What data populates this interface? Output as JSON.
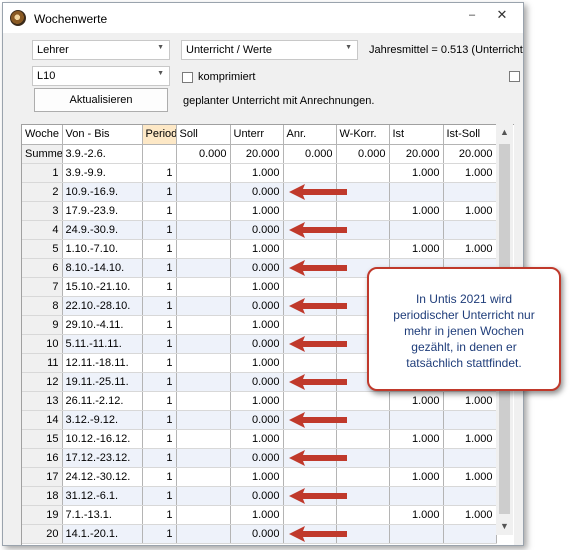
{
  "window": {
    "title": "Wochenwerte",
    "minimize": "–",
    "close": "✕"
  },
  "toolbar": {
    "lehrer": "Lehrer",
    "element": "L10",
    "mode": "Unterricht / Werte",
    "jahresmittel": "Jahresmittel = 0.513 (Unterricht",
    "komprimiert": "komprimiert",
    "aktualisieren": "Aktualisieren",
    "info": "geplanter Unterricht mit Anrechnungen."
  },
  "table": {
    "headers": [
      "Woche",
      "Von - Bis",
      "Period",
      "Soll",
      "Unterr",
      "Anr.",
      "W-Korr.",
      "Ist",
      "Ist-Soll"
    ],
    "sum": [
      "Summe",
      "3.9.-2.6.",
      "",
      "0.000",
      "20.000",
      "0.000",
      "0.000",
      "20.000",
      "20.000"
    ],
    "rows": [
      [
        "1",
        "3.9.-9.9.",
        "1",
        "",
        "1.000",
        "",
        "",
        "1.000",
        "1.000"
      ],
      [
        "2",
        "10.9.-16.9.",
        "1",
        "",
        "0.000",
        "",
        "",
        "",
        ""
      ],
      [
        "3",
        "17.9.-23.9.",
        "1",
        "",
        "1.000",
        "",
        "",
        "1.000",
        "1.000"
      ],
      [
        "4",
        "24.9.-30.9.",
        "1",
        "",
        "0.000",
        "",
        "",
        "",
        ""
      ],
      [
        "5",
        "1.10.-7.10.",
        "1",
        "",
        "1.000",
        "",
        "",
        "1.000",
        "1.000"
      ],
      [
        "6",
        "8.10.-14.10.",
        "1",
        "",
        "0.000",
        "",
        "",
        "",
        ""
      ],
      [
        "7",
        "15.10.-21.10.",
        "1",
        "",
        "1.000",
        "",
        "",
        "",
        ""
      ],
      [
        "8",
        "22.10.-28.10.",
        "1",
        "",
        "0.000",
        "",
        "",
        "",
        ""
      ],
      [
        "9",
        "29.10.-4.11.",
        "1",
        "",
        "1.000",
        "",
        "",
        "",
        ""
      ],
      [
        "10",
        "5.11.-11.11.",
        "1",
        "",
        "0.000",
        "",
        "",
        "",
        ""
      ],
      [
        "11",
        "12.11.-18.11.",
        "1",
        "",
        "1.000",
        "",
        "",
        "",
        ""
      ],
      [
        "12",
        "19.11.-25.11.",
        "1",
        "",
        "0.000",
        "",
        "",
        "",
        ""
      ],
      [
        "13",
        "26.11.-2.12.",
        "1",
        "",
        "1.000",
        "",
        "",
        "1.000",
        "1.000"
      ],
      [
        "14",
        "3.12.-9.12.",
        "1",
        "",
        "0.000",
        "",
        "",
        "",
        ""
      ],
      [
        "15",
        "10.12.-16.12.",
        "1",
        "",
        "1.000",
        "",
        "",
        "1.000",
        "1.000"
      ],
      [
        "16",
        "17.12.-23.12.",
        "1",
        "",
        "0.000",
        "",
        "",
        "",
        ""
      ],
      [
        "17",
        "24.12.-30.12.",
        "1",
        "",
        "1.000",
        "",
        "",
        "1.000",
        "1.000"
      ],
      [
        "18",
        "31.12.-6.1.",
        "1",
        "",
        "0.000",
        "",
        "",
        "",
        ""
      ],
      [
        "19",
        "7.1.-13.1.",
        "1",
        "",
        "1.000",
        "",
        "",
        "1.000",
        "1.000"
      ],
      [
        "20",
        "14.1.-20.1.",
        "1",
        "",
        "0.000",
        "",
        "",
        "",
        ""
      ]
    ]
  },
  "callout": {
    "text": "In Untis 2021 wird periodischer Unterricht nur mehr in jenen Wochen gezählt, in denen er tatsächlich stattfindet."
  },
  "colors": {
    "arrow": "#c0392b",
    "callout_border": "#c0392b",
    "callout_text": "#1f3d7a",
    "period_header": "#fde8c6",
    "alt_row": "#eef2fa"
  },
  "icons": {
    "app": "clock-icon",
    "arrow": "left-arrow-icon",
    "scroll_up": "scroll-up-icon",
    "scroll_down": "scroll-down-icon"
  }
}
